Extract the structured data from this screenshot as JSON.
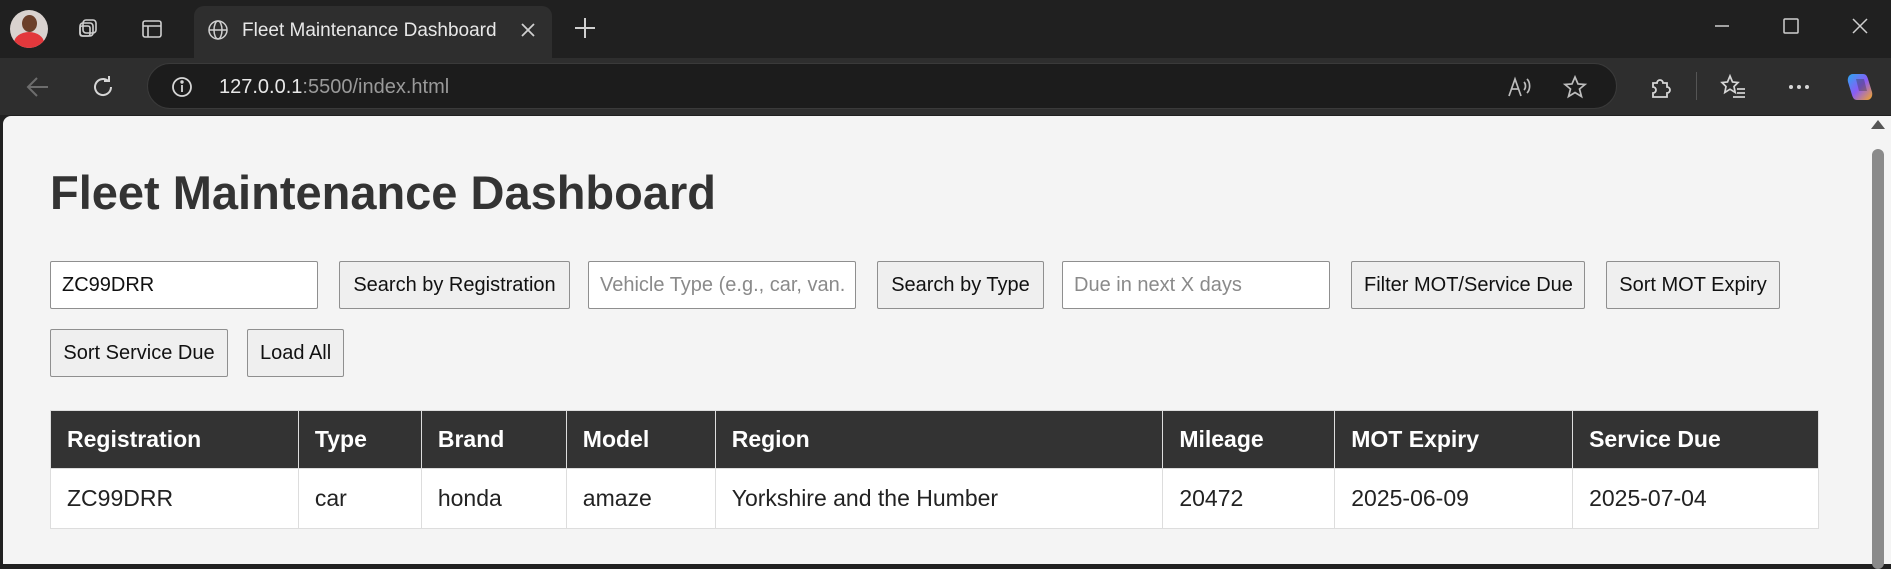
{
  "browser": {
    "tab": {
      "title": "Fleet Maintenance Dashboard"
    },
    "address": {
      "host": "127.0.0.1",
      "rest": ":5500/index.html"
    }
  },
  "page": {
    "title": "Fleet Maintenance Dashboard",
    "controls": {
      "registration_input_value": "ZC99DRR",
      "search_registration_label": "Search by Registration",
      "type_input_placeholder": "Vehicle Type (e.g., car, van...)",
      "search_type_label": "Search by Type",
      "days_input_placeholder": "Due in next X days",
      "filter_due_label": "Filter MOT/Service Due",
      "sort_mot_label": "Sort MOT Expiry",
      "sort_service_label": "Sort Service Due",
      "load_all_label": "Load All"
    },
    "table": {
      "headers": [
        "Registration",
        "Type",
        "Brand",
        "Model",
        "Region",
        "Mileage",
        "MOT Expiry",
        "Service Due"
      ],
      "rows": [
        [
          "ZC99DRR",
          "car",
          "honda",
          "amaze",
          "Yorkshire and the Humber",
          "20472",
          "2025-06-09",
          "2025-07-04"
        ]
      ]
    }
  }
}
